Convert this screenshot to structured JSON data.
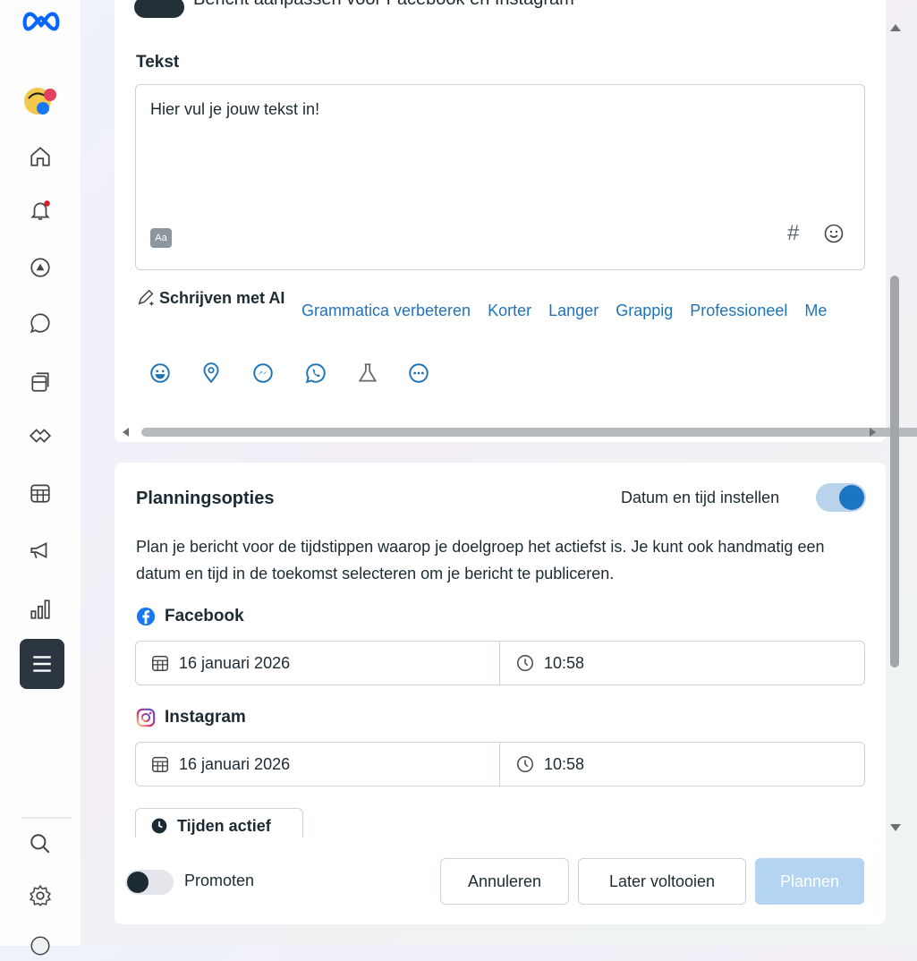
{
  "top_partial": {
    "toggle_label": "Bericht aanpassen voor Facebook en Instagram"
  },
  "post": {
    "label": "Tekst",
    "text_value": "Hier vul je jouw tekst in!",
    "format_button": "Aa",
    "hashtag_symbol": "#"
  },
  "ai": {
    "label": "Schrijven met AI",
    "chips": [
      "Grammatica verbeteren",
      "Korter",
      "Langer",
      "Grappig",
      "Professioneel",
      "Me"
    ]
  },
  "planning": {
    "title": "Planningsopties",
    "toggle_label": "Datum en tijd instellen",
    "toggle_on": true,
    "description": "Plan je bericht voor de tijdstippen waarop je doelgroep het actiefst is. Je kunt ook handmatig een datum en tijd in de toekomst selecteren om je bericht te publiceren.",
    "facebook": {
      "label": "Facebook",
      "date": "16 januari 2026",
      "time": "10:58"
    },
    "instagram": {
      "label": "Instagram",
      "date": "16 januari 2026",
      "time": "10:58"
    },
    "active_times_button": "Tijden actief"
  },
  "footer": {
    "promote_label": "Promoten",
    "promote_on": false,
    "cancel": "Annuleren",
    "later": "Later voltooien",
    "plan": "Plannen"
  },
  "colors": {
    "accent": "#1b74c4",
    "link": "#1f74b8",
    "disabled_primary": "#b3d4f3",
    "dark": "#1c2b33"
  }
}
